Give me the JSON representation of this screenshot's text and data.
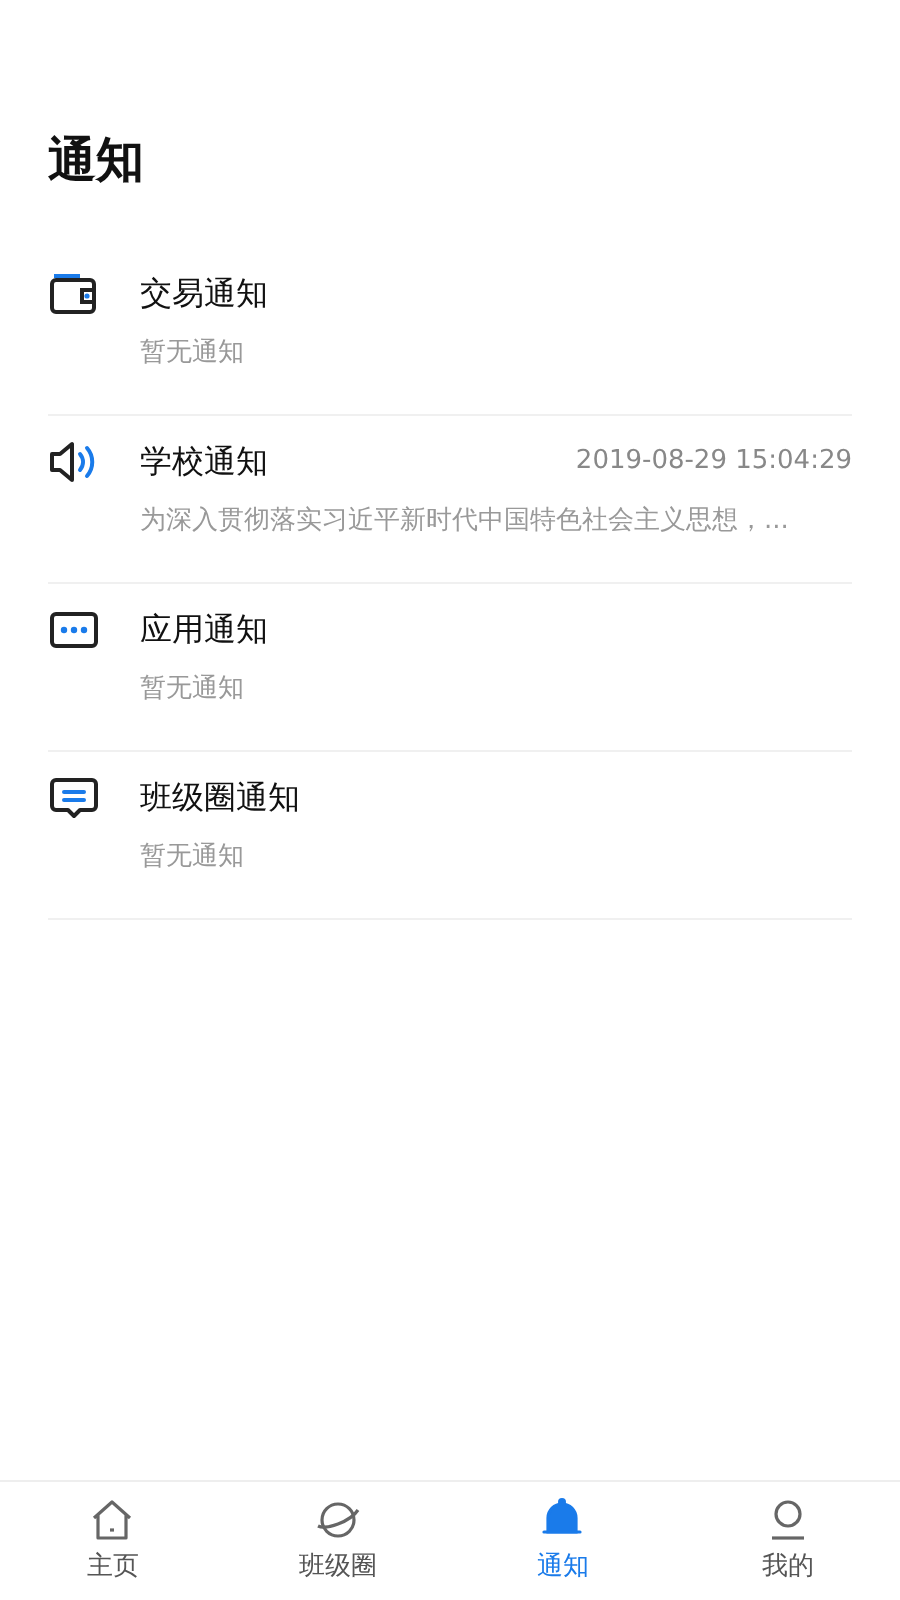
{
  "page_title": "通知",
  "notifications": [
    {
      "kind": "wallet",
      "title": "交易通知",
      "preview": "暂无通知"
    },
    {
      "kind": "speaker",
      "title": "学校通知",
      "time": "2019-08-29 15:04:29",
      "preview": "为深入贯彻落实习近平新时代中国特色社会主义思想，..."
    },
    {
      "kind": "dots",
      "title": "应用通知",
      "preview": "暂无通知"
    },
    {
      "kind": "chat",
      "title": "班级圈通知",
      "preview": "暂无通知"
    }
  ],
  "tab_bar": [
    {
      "kind": "home",
      "label": "主页",
      "selected": false
    },
    {
      "kind": "planet",
      "label": "班级圈",
      "selected": false
    },
    {
      "kind": "bell",
      "label": "通知",
      "selected": true
    },
    {
      "kind": "person",
      "label": "我的",
      "selected": false
    }
  ]
}
